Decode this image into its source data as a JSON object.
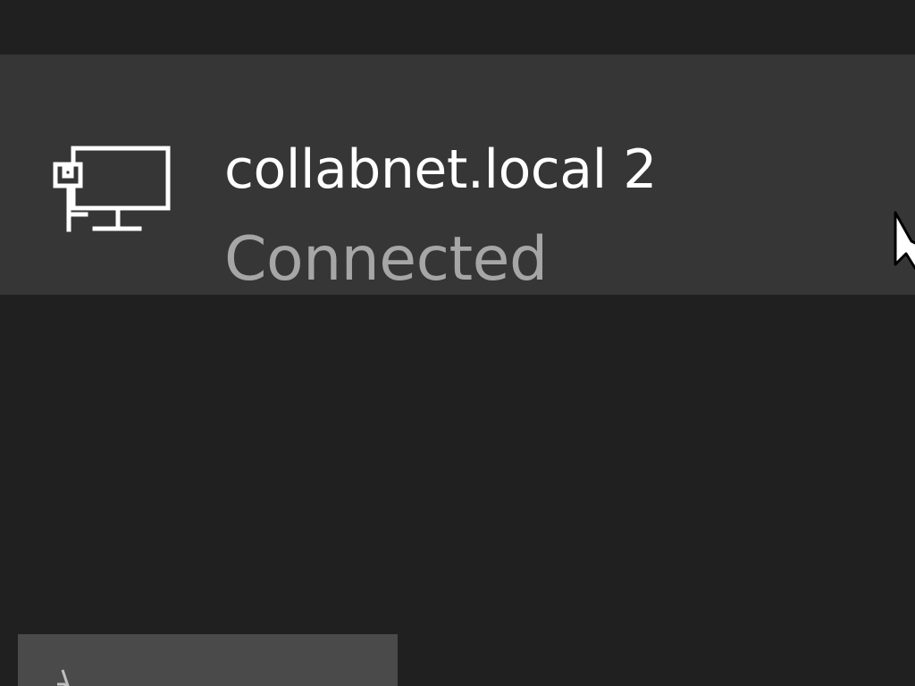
{
  "network": {
    "name": "collabnet.local 2",
    "status": "Connected",
    "icon": "wired-network-icon"
  },
  "bottom_tile": {
    "icon": "airplane-mode-icon"
  },
  "colors": {
    "background": "#202020",
    "item_background": "#363636",
    "primary_text": "#ffffff",
    "secondary_text": "#a6a6a6",
    "tile_background": "#4a4a4a"
  }
}
